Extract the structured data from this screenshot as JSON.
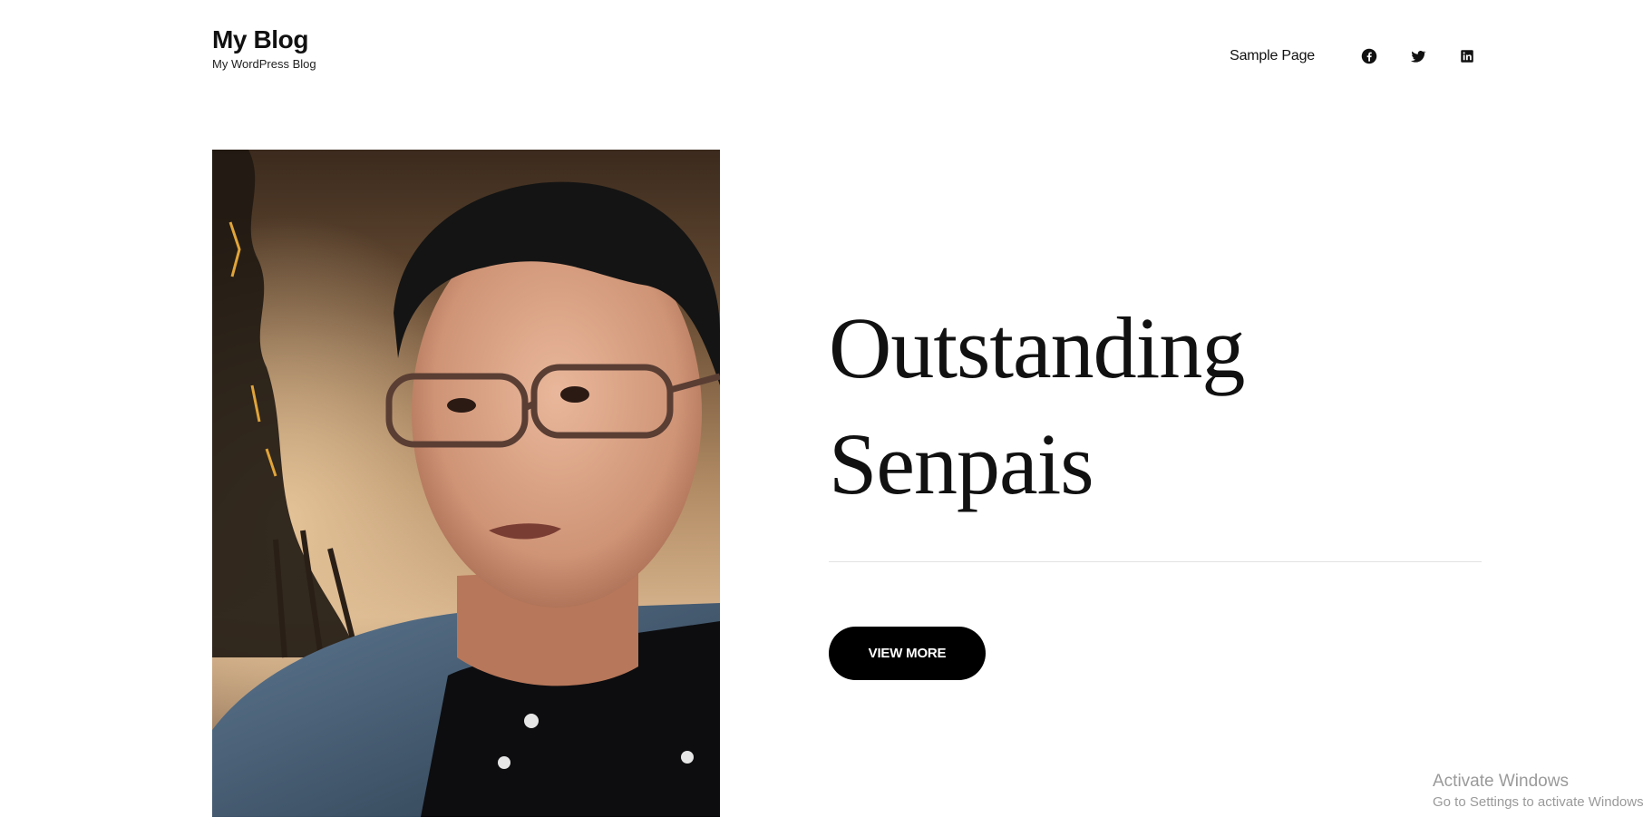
{
  "site": {
    "title": "My Blog",
    "tagline": "My WordPress Blog"
  },
  "nav": {
    "items": [
      {
        "label": "Sample Page"
      }
    ],
    "social": [
      {
        "icon": "facebook-icon"
      },
      {
        "icon": "twitter-icon"
      },
      {
        "icon": "linkedin-icon"
      }
    ]
  },
  "hero": {
    "title": "Outstanding Senpais",
    "button_label": "VIEW MORE",
    "image_icon": "portrait-photo"
  },
  "watermark": {
    "title": "Activate Windows",
    "subtitle": "Go to Settings to activate Windows."
  },
  "colors": {
    "background": "#ffffff",
    "text": "#111111",
    "button": "#000000",
    "button_text": "#ffffff",
    "divider": "#e2e2e2",
    "watermark": "#9a9a9a"
  }
}
